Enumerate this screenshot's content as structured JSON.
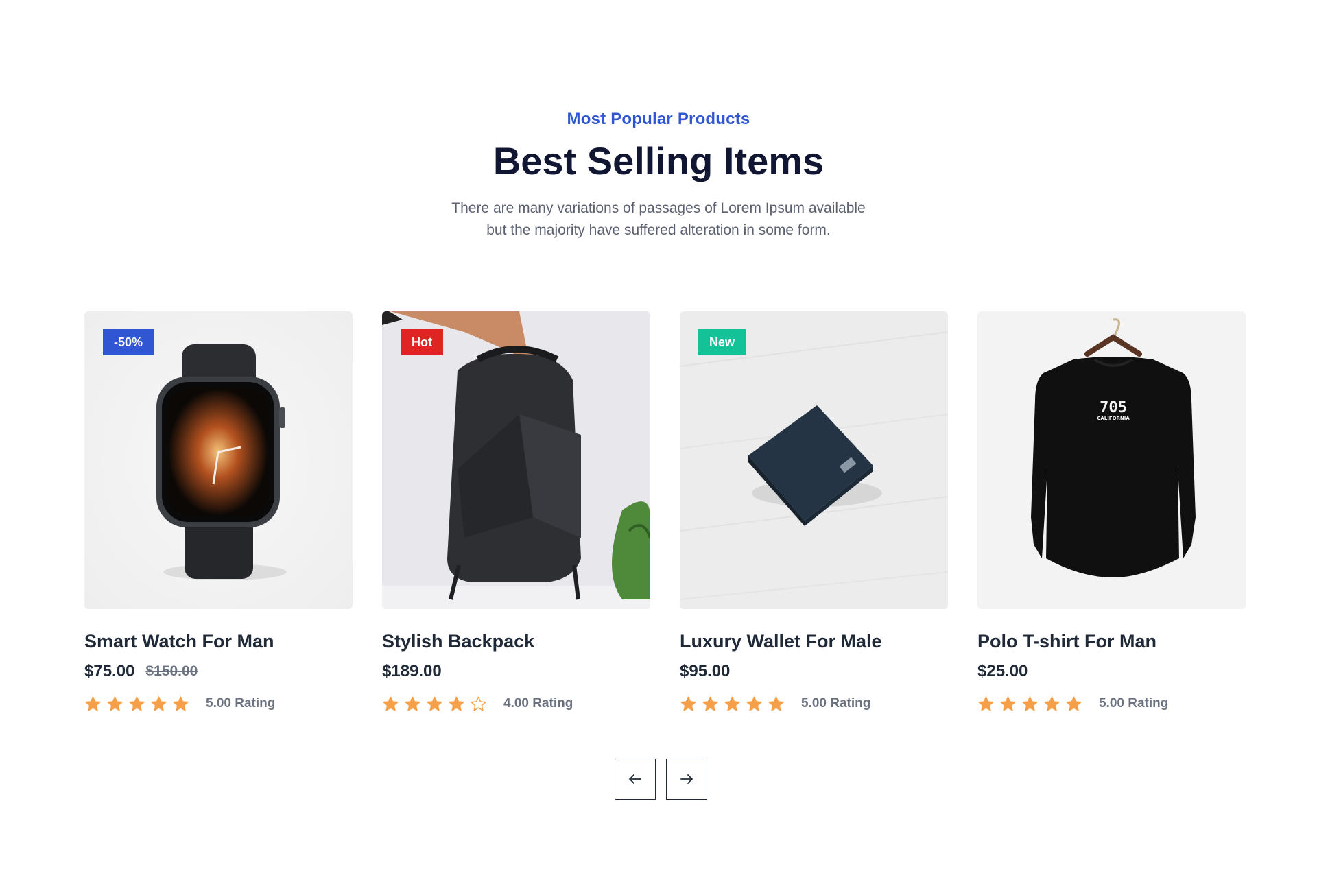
{
  "header": {
    "eyebrow": "Most Popular Products",
    "title": "Best Selling Items",
    "description_line1": "There are many variations of passages of Lorem Ipsum available",
    "description_line2": "but the majority have suffered alteration in some form."
  },
  "colors": {
    "accent": "#3056d3",
    "badge_sale": "#3056d3",
    "badge_hot": "#e02424",
    "badge_new": "#13c296",
    "star": "#f5a049"
  },
  "products": [
    {
      "badge": "-50%",
      "badge_type": "sale",
      "name": "Smart Watch For Man",
      "price": "$75.00",
      "old_price": "$150.00",
      "rating": 5,
      "rating_label": "5.00 Rating",
      "image": "smart-watch-image"
    },
    {
      "badge": "Hot",
      "badge_type": "hot",
      "name": "Stylish Backpack",
      "price": "$189.00",
      "old_price": "",
      "rating": 4,
      "rating_label": "4.00 Rating",
      "image": "backpack-image"
    },
    {
      "badge": "New",
      "badge_type": "new",
      "name": "Luxury Wallet For Male",
      "price": "$95.00",
      "old_price": "",
      "rating": 5,
      "rating_label": "5.00 Rating",
      "image": "wallet-image"
    },
    {
      "badge": "",
      "badge_type": "",
      "name": "Polo T-shirt For Man",
      "price": "$25.00",
      "old_price": "",
      "rating": 5,
      "rating_label": "5.00 Rating",
      "image": "tshirt-image",
      "tshirt_print": "705",
      "tshirt_print_small": "CALIFORNIA"
    }
  ],
  "carousel": {
    "prev_icon": "arrow-left-icon",
    "next_icon": "arrow-right-icon"
  }
}
